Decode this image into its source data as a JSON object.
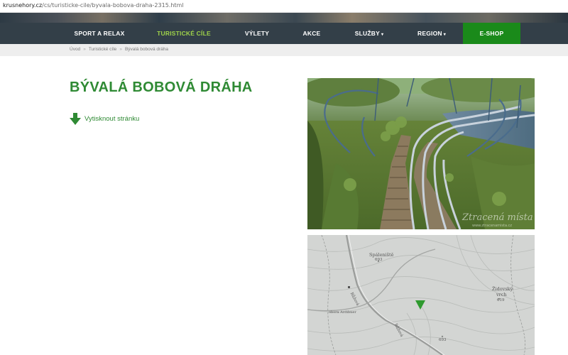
{
  "browser": {
    "url_host": "krusnehory.cz",
    "url_path": "/cs/turisticke-cile/byvala-bobova-draha-2315.html"
  },
  "nav": {
    "items": [
      {
        "label": "SPORT A RELAX"
      },
      {
        "label": "TURISTICKÉ CÍLE"
      },
      {
        "label": "VÝLETY"
      },
      {
        "label": "AKCE"
      },
      {
        "label": "SLUŽBY",
        "caret": "▾"
      },
      {
        "label": "REGION",
        "caret": "▾"
      },
      {
        "label": "E-SHOP"
      }
    ],
    "active_color": "#9fd24a",
    "shop_color": "#1a8a1a",
    "bar_color": "#333f48"
  },
  "breadcrumb": {
    "items": [
      "Úvod",
      "Turistické cíle",
      "Bývalá bobová dráha"
    ],
    "separator": "»"
  },
  "page": {
    "title": "BÝVALÁ BOBOVÁ DRÁHA",
    "print_label": "Vytisknout stránku",
    "accent_color": "#2f8a34"
  },
  "photo": {
    "watermark": "Ztracená místa",
    "watermark_sub": "www.ztracenamista.cz"
  },
  "map": {
    "labels": {
      "spaleniste": "Spáleniště",
      "spaleniste_elev": "693",
      "zidovsky": "Židovský",
      "vrch": "vrch",
      "zidovsky_elev": "619",
      "ruzova1": "Růžová",
      "ruzova2": "Růžová",
      "obora": "obora Ardibner",
      "peak": "693"
    },
    "marker_color": "#2f9a2f"
  }
}
